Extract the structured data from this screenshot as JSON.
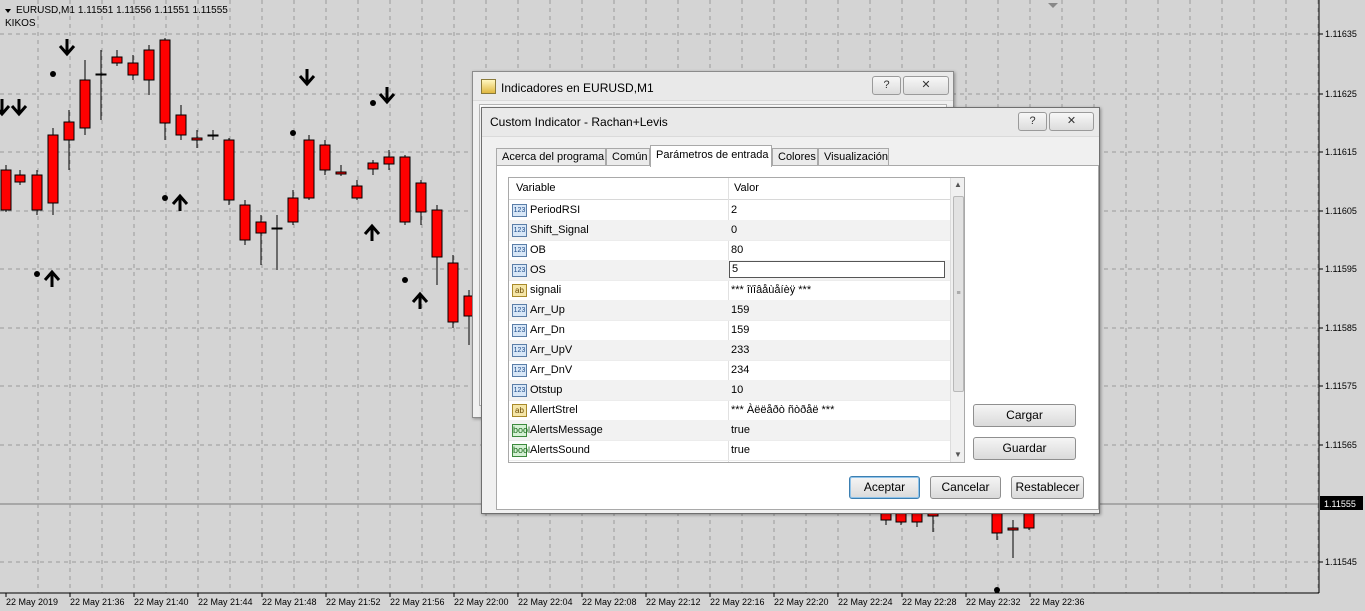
{
  "chart": {
    "symbol": "EURUSD,M1",
    "ohlc": "1.11551 1.11556 1.11551 1.11555",
    "indicator_name": "KIKOS",
    "price_levels": [
      "1.11635",
      "1.11625",
      "1.11615",
      "1.11605",
      "1.11595",
      "1.11585",
      "1.11575",
      "1.11565",
      "1.11555",
      "1.11545"
    ],
    "current_price": "1.11555",
    "time_labels": [
      "22 May 2019",
      "22 May 21:36",
      "22 May 21:40",
      "22 May 21:44",
      "22 May 21:48",
      "22 May 21:52",
      "22 May 21:56",
      "22 May 22:00",
      "22 May 22:04",
      "22 May 22:08",
      "22 May 22:12",
      "22 May 22:16",
      "22 May 22:20",
      "22 May 22:24",
      "22 May 22:28",
      "22 May 22:32",
      "22 May 22:36"
    ],
    "colors": {
      "background": "#d4d4d4",
      "bull": "#7cfc00",
      "bear": "#ff0000",
      "grid": "#9a9a9a"
    }
  },
  "dialog_back": {
    "title": "Indicadores en EURUSD,M1",
    "help": "?",
    "close": "✕"
  },
  "dialog": {
    "title": "Custom Indicator - Rachan+Levis",
    "help": "?",
    "close": "✕",
    "tabs": [
      {
        "label": "Acerca del programa",
        "active": false
      },
      {
        "label": "Común",
        "active": false
      },
      {
        "label": "Parámetros de entrada",
        "active": true
      },
      {
        "label": "Colores",
        "active": false
      },
      {
        "label": "Visualización",
        "active": false
      }
    ],
    "grid": {
      "col_variable": "Variable",
      "col_value": "Valor",
      "rows": [
        {
          "type": "123",
          "var": "PeriodRSI",
          "val": "2"
        },
        {
          "type": "123",
          "var": "Shift_Signal",
          "val": "0"
        },
        {
          "type": "123",
          "var": "OB",
          "val": "80"
        },
        {
          "type": "123",
          "var": "OS",
          "val": "5",
          "editing": true
        },
        {
          "type": "ab",
          "var": "signali",
          "val": "*** îïîâåùåíèÿ  ***"
        },
        {
          "type": "123",
          "var": "Arr_Up",
          "val": "159"
        },
        {
          "type": "123",
          "var": "Arr_Dn",
          "val": "159"
        },
        {
          "type": "123",
          "var": "Arr_UpV",
          "val": "233"
        },
        {
          "type": "123",
          "var": "Arr_DnV",
          "val": "234"
        },
        {
          "type": "123",
          "var": "Otstup",
          "val": "10"
        },
        {
          "type": "ab",
          "var": "AllertStrel",
          "val": "*** Àëëåðò ñòðåë  ***"
        },
        {
          "type": "bool",
          "var": "AlertsMessage",
          "val": "true"
        },
        {
          "type": "bool",
          "var": "AlertsSound",
          "val": "true"
        }
      ]
    },
    "buttons": {
      "load": "Cargar",
      "save": "Guardar",
      "ok": "Aceptar",
      "cancel": "Cancelar",
      "reset": "Restablecer"
    }
  }
}
